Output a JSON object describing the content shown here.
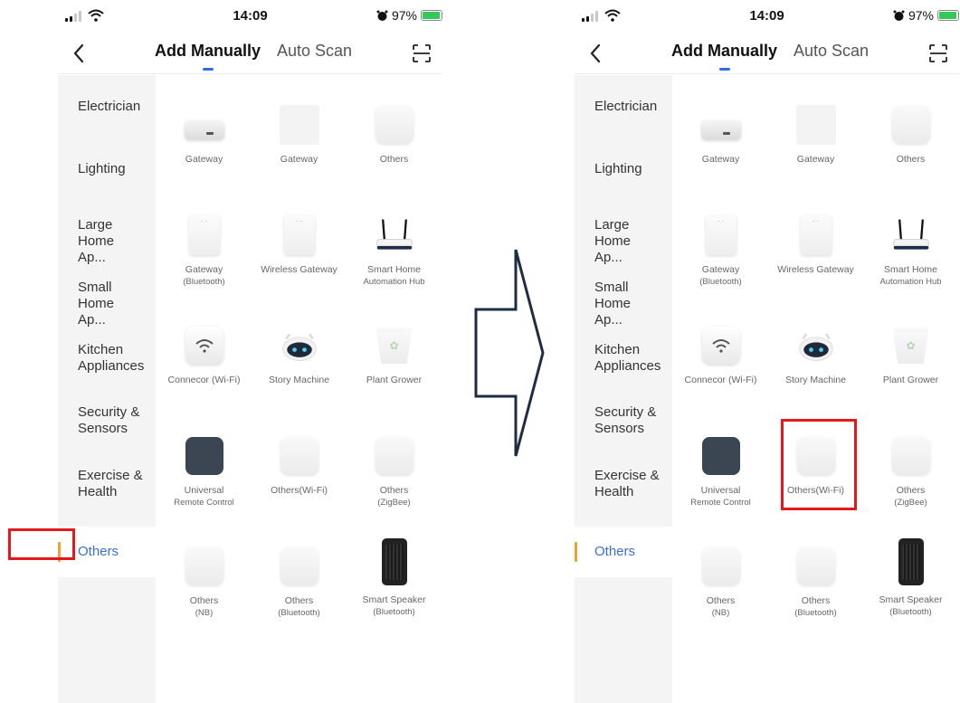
{
  "status": {
    "time": "14:09",
    "battery": "97%",
    "battery_level": 0.97
  },
  "nav": {
    "tab_add": "Add Manually",
    "tab_scan": "Auto Scan"
  },
  "categories": [
    "Electrician",
    "Lighting",
    "Large Home Ap...",
    "Small Home Ap...",
    "Kitchen Appliances",
    "Security & Sensors",
    "Exercise & Health",
    "Others"
  ],
  "devices": [
    {
      "label": "Gateway",
      "sub": "",
      "icon": "gateway-icon"
    },
    {
      "label": "Gateway",
      "sub": "",
      "icon": "gateway-placeholder-icon"
    },
    {
      "label": "Others",
      "sub": "",
      "icon": "device-tile-icon"
    },
    {
      "label": "Gateway",
      "sub": "(Bluetooth)",
      "icon": "bluetooth-gateway-icon"
    },
    {
      "label": "Wireless Gateway",
      "sub": "",
      "icon": "wireless-gateway-icon"
    },
    {
      "label": "Smart Home",
      "sub": "Automation Hub",
      "icon": "router-icon"
    },
    {
      "label": "Connecor (Wi-Fi)",
      "sub": "",
      "icon": "wifi-connector-icon"
    },
    {
      "label": "Story Machine",
      "sub": "",
      "icon": "robot-icon"
    },
    {
      "label": "Plant Grower",
      "sub": "",
      "icon": "plant-pot-icon"
    },
    {
      "label": "Universal",
      "sub": "Remote Control",
      "icon": "remote-control-icon"
    },
    {
      "label": "Others(Wi-Fi)",
      "sub": "",
      "icon": "device-tile-icon"
    },
    {
      "label": "Others",
      "sub": "(ZigBee)",
      "icon": "device-tile-icon"
    },
    {
      "label": "Others",
      "sub": "(NB)",
      "icon": "device-tile-icon"
    },
    {
      "label": "Others",
      "sub": "(Bluetooth)",
      "icon": "device-tile-icon"
    },
    {
      "label": "Smart Speaker",
      "sub": "(Bluetooth)",
      "icon": "speaker-icon"
    }
  ],
  "colors": {
    "accent_tab": "#2f6ee5",
    "active_category": "#3b6fd4",
    "active_marker": "#f0a133",
    "highlight": "#e3191c",
    "arrow": "#1e2d45"
  }
}
